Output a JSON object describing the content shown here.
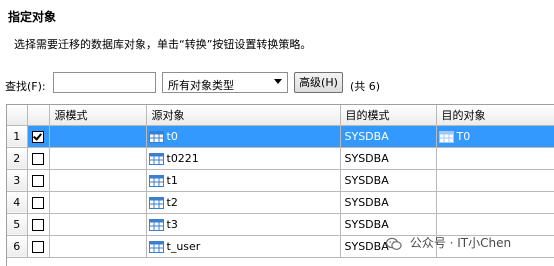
{
  "header": {
    "title": "指定对象",
    "description": "选择需要迁移的数据库对象，单击“转换”按钮设置转换策略。"
  },
  "toolbar": {
    "search_label": "查找(F):",
    "search_value": "",
    "type_filter": "所有对象类型",
    "advanced_label": "高级(H)",
    "count_text": "(共 6)"
  },
  "grid": {
    "columns": [
      "",
      "",
      "源模式",
      "源对象",
      "目的模式",
      "目的对象"
    ],
    "rows": [
      {
        "num": "1",
        "checked": true,
        "src_schema": "",
        "src_object": "t0",
        "dst_schema": "SYSDBA",
        "dst_object": "T0"
      },
      {
        "num": "2",
        "checked": false,
        "src_schema": "",
        "src_object": "t0221",
        "dst_schema": "SYSDBA",
        "dst_object": ""
      },
      {
        "num": "3",
        "checked": false,
        "src_schema": "",
        "src_object": "t1",
        "dst_schema": "SYSDBA",
        "dst_object": ""
      },
      {
        "num": "4",
        "checked": false,
        "src_schema": "",
        "src_object": "t2",
        "dst_schema": "SYSDBA",
        "dst_object": ""
      },
      {
        "num": "5",
        "checked": false,
        "src_schema": "",
        "src_object": "t3",
        "dst_schema": "SYSDBA",
        "dst_object": ""
      },
      {
        "num": "6",
        "checked": false,
        "src_schema": "",
        "src_object": "t_user",
        "dst_schema": "SYSDBA",
        "dst_object": ""
      }
    ]
  },
  "watermark": {
    "text": "公众号 · IT小Chen",
    "icon": "wechat-icon"
  },
  "colors": {
    "selection": "#3399ff",
    "table_icon": "#3a7fd0"
  }
}
